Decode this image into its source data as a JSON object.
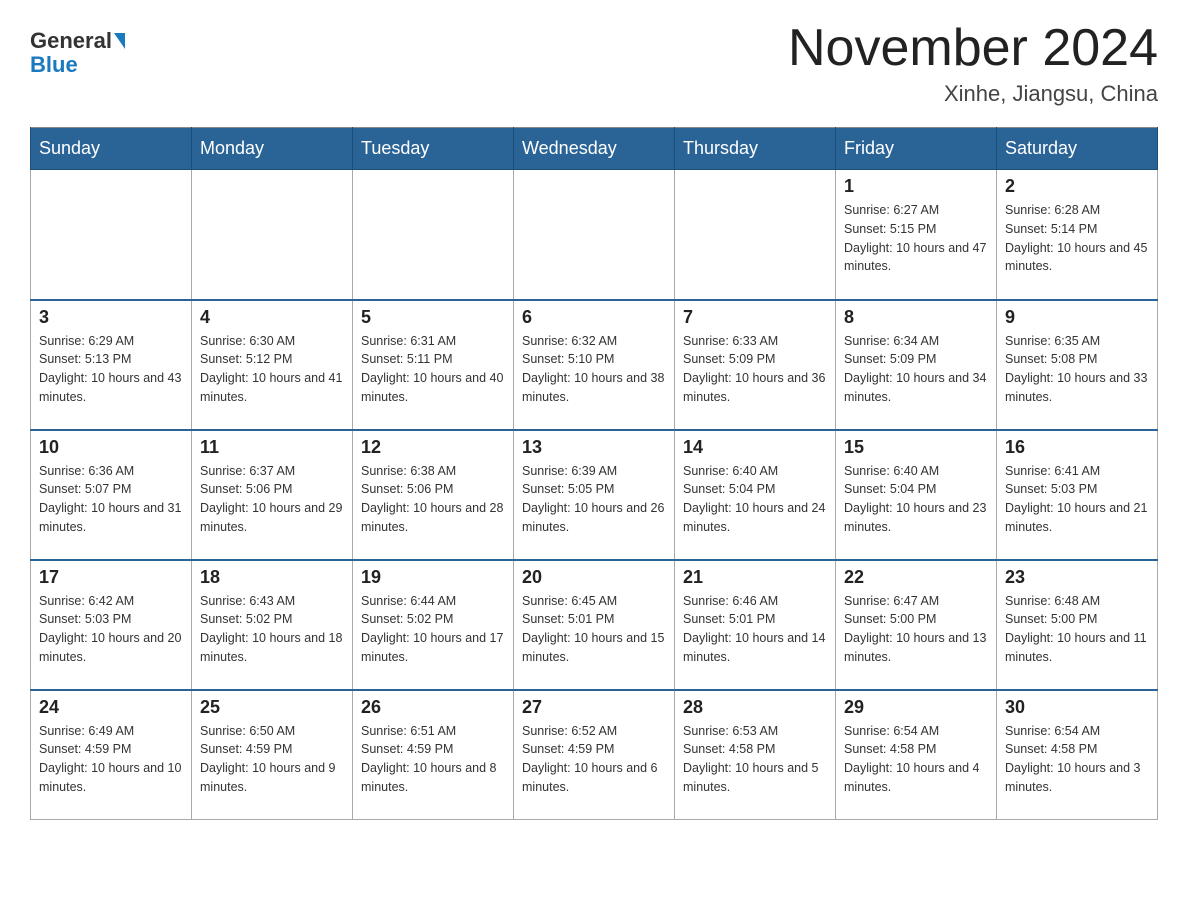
{
  "header": {
    "logo_general": "General",
    "logo_blue": "Blue",
    "month_title": "November 2024",
    "location": "Xinhe, Jiangsu, China"
  },
  "days_of_week": [
    "Sunday",
    "Monday",
    "Tuesday",
    "Wednesday",
    "Thursday",
    "Friday",
    "Saturday"
  ],
  "weeks": [
    [
      {
        "day": "",
        "info": ""
      },
      {
        "day": "",
        "info": ""
      },
      {
        "day": "",
        "info": ""
      },
      {
        "day": "",
        "info": ""
      },
      {
        "day": "",
        "info": ""
      },
      {
        "day": "1",
        "info": "Sunrise: 6:27 AM\nSunset: 5:15 PM\nDaylight: 10 hours and 47 minutes."
      },
      {
        "day": "2",
        "info": "Sunrise: 6:28 AM\nSunset: 5:14 PM\nDaylight: 10 hours and 45 minutes."
      }
    ],
    [
      {
        "day": "3",
        "info": "Sunrise: 6:29 AM\nSunset: 5:13 PM\nDaylight: 10 hours and 43 minutes."
      },
      {
        "day": "4",
        "info": "Sunrise: 6:30 AM\nSunset: 5:12 PM\nDaylight: 10 hours and 41 minutes."
      },
      {
        "day": "5",
        "info": "Sunrise: 6:31 AM\nSunset: 5:11 PM\nDaylight: 10 hours and 40 minutes."
      },
      {
        "day": "6",
        "info": "Sunrise: 6:32 AM\nSunset: 5:10 PM\nDaylight: 10 hours and 38 minutes."
      },
      {
        "day": "7",
        "info": "Sunrise: 6:33 AM\nSunset: 5:09 PM\nDaylight: 10 hours and 36 minutes."
      },
      {
        "day": "8",
        "info": "Sunrise: 6:34 AM\nSunset: 5:09 PM\nDaylight: 10 hours and 34 minutes."
      },
      {
        "day": "9",
        "info": "Sunrise: 6:35 AM\nSunset: 5:08 PM\nDaylight: 10 hours and 33 minutes."
      }
    ],
    [
      {
        "day": "10",
        "info": "Sunrise: 6:36 AM\nSunset: 5:07 PM\nDaylight: 10 hours and 31 minutes."
      },
      {
        "day": "11",
        "info": "Sunrise: 6:37 AM\nSunset: 5:06 PM\nDaylight: 10 hours and 29 minutes."
      },
      {
        "day": "12",
        "info": "Sunrise: 6:38 AM\nSunset: 5:06 PM\nDaylight: 10 hours and 28 minutes."
      },
      {
        "day": "13",
        "info": "Sunrise: 6:39 AM\nSunset: 5:05 PM\nDaylight: 10 hours and 26 minutes."
      },
      {
        "day": "14",
        "info": "Sunrise: 6:40 AM\nSunset: 5:04 PM\nDaylight: 10 hours and 24 minutes."
      },
      {
        "day": "15",
        "info": "Sunrise: 6:40 AM\nSunset: 5:04 PM\nDaylight: 10 hours and 23 minutes."
      },
      {
        "day": "16",
        "info": "Sunrise: 6:41 AM\nSunset: 5:03 PM\nDaylight: 10 hours and 21 minutes."
      }
    ],
    [
      {
        "day": "17",
        "info": "Sunrise: 6:42 AM\nSunset: 5:03 PM\nDaylight: 10 hours and 20 minutes."
      },
      {
        "day": "18",
        "info": "Sunrise: 6:43 AM\nSunset: 5:02 PM\nDaylight: 10 hours and 18 minutes."
      },
      {
        "day": "19",
        "info": "Sunrise: 6:44 AM\nSunset: 5:02 PM\nDaylight: 10 hours and 17 minutes."
      },
      {
        "day": "20",
        "info": "Sunrise: 6:45 AM\nSunset: 5:01 PM\nDaylight: 10 hours and 15 minutes."
      },
      {
        "day": "21",
        "info": "Sunrise: 6:46 AM\nSunset: 5:01 PM\nDaylight: 10 hours and 14 minutes."
      },
      {
        "day": "22",
        "info": "Sunrise: 6:47 AM\nSunset: 5:00 PM\nDaylight: 10 hours and 13 minutes."
      },
      {
        "day": "23",
        "info": "Sunrise: 6:48 AM\nSunset: 5:00 PM\nDaylight: 10 hours and 11 minutes."
      }
    ],
    [
      {
        "day": "24",
        "info": "Sunrise: 6:49 AM\nSunset: 4:59 PM\nDaylight: 10 hours and 10 minutes."
      },
      {
        "day": "25",
        "info": "Sunrise: 6:50 AM\nSunset: 4:59 PM\nDaylight: 10 hours and 9 minutes."
      },
      {
        "day": "26",
        "info": "Sunrise: 6:51 AM\nSunset: 4:59 PM\nDaylight: 10 hours and 8 minutes."
      },
      {
        "day": "27",
        "info": "Sunrise: 6:52 AM\nSunset: 4:59 PM\nDaylight: 10 hours and 6 minutes."
      },
      {
        "day": "28",
        "info": "Sunrise: 6:53 AM\nSunset: 4:58 PM\nDaylight: 10 hours and 5 minutes."
      },
      {
        "day": "29",
        "info": "Sunrise: 6:54 AM\nSunset: 4:58 PM\nDaylight: 10 hours and 4 minutes."
      },
      {
        "day": "30",
        "info": "Sunrise: 6:54 AM\nSunset: 4:58 PM\nDaylight: 10 hours and 3 minutes."
      }
    ]
  ]
}
